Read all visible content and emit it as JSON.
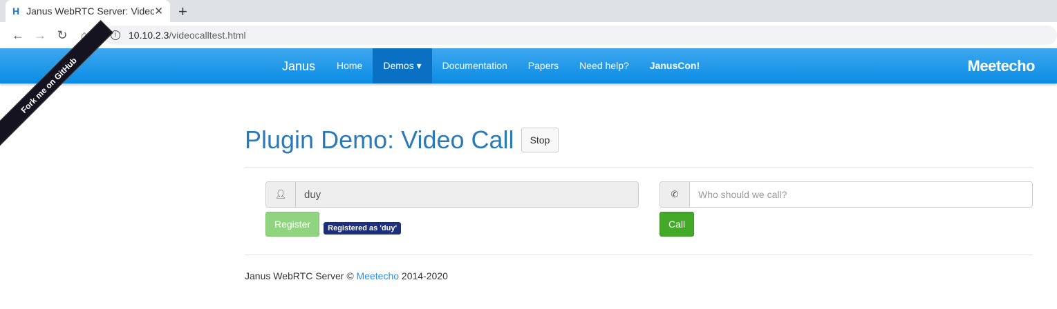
{
  "browser": {
    "tab_title": "Janus WebRTC Server: Video Call",
    "url_host": "10.10.2.3",
    "url_path": "/videocalltest.html"
  },
  "navbar": {
    "brand": "Janus",
    "items": [
      "Home",
      "Demos ▾",
      "Documentation",
      "Papers",
      "Need help?",
      "JanusCon!"
    ],
    "logo": "Meetecho"
  },
  "ribbon": "Fork me on GitHub",
  "page": {
    "title": "Plugin Demo: Video Call",
    "stop": "Stop"
  },
  "register": {
    "username": "duy",
    "button": "Register",
    "badge": "Registered as 'duy'"
  },
  "call": {
    "placeholder": "Who should we call?",
    "button": "Call"
  },
  "footer": {
    "prefix": "Janus WebRTC Server © ",
    "link": "Meetecho",
    "suffix": " 2014-2020"
  }
}
